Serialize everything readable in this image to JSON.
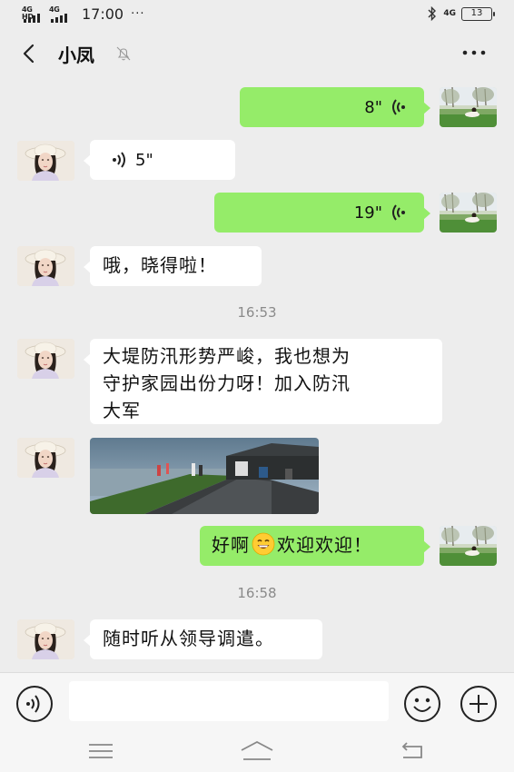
{
  "status_bar": {
    "signal_1": "4G HD",
    "signal_2": "4G",
    "time": "17:00",
    "more_dots": "···",
    "network": "4G",
    "battery": "13"
  },
  "header": {
    "title": "小凤",
    "back_icon": "chevron-left-icon",
    "mute_icon": "bell-muted-icon",
    "more_icon": "ellipsis-icon"
  },
  "messages": [
    {
      "type": "voice",
      "direction": "out",
      "duration": "8\""
    },
    {
      "type": "voice",
      "direction": "in",
      "duration": "5\""
    },
    {
      "type": "voice",
      "direction": "out",
      "duration": "19\""
    },
    {
      "type": "text",
      "direction": "in",
      "text": "哦，晓得啦！"
    },
    {
      "type": "time",
      "text": "16:53"
    },
    {
      "type": "text",
      "direction": "in",
      "lines": [
        "大堤防汛形势严峻，我也想为",
        "守护家园出份力呀！加入防汛",
        "大军"
      ]
    },
    {
      "type": "image",
      "direction": "in",
      "description_icon": "flood-embankment-photo"
    },
    {
      "type": "text",
      "direction": "out",
      "text_before": "好啊",
      "emoji": "grinning-emoji",
      "text_after": "欢迎欢迎！"
    },
    {
      "type": "time",
      "text": "16:58"
    },
    {
      "type": "text",
      "direction": "in",
      "text": "随时听从领导调遣。"
    }
  ],
  "input_bar": {
    "voice_icon": "voice-input-icon",
    "placeholder": "",
    "emoji_icon": "smiley-icon",
    "plus_icon": "plus-circle-icon"
  },
  "nav_bar": {
    "menu_icon": "menu-icon",
    "home_icon": "home-icon",
    "back_icon": "back-arrow-icon"
  },
  "colors": {
    "background": "#ededed",
    "outgoing_bubble": "#95ec69",
    "incoming_bubble": "#ffffff",
    "timestamp": "#8a8a8a"
  }
}
